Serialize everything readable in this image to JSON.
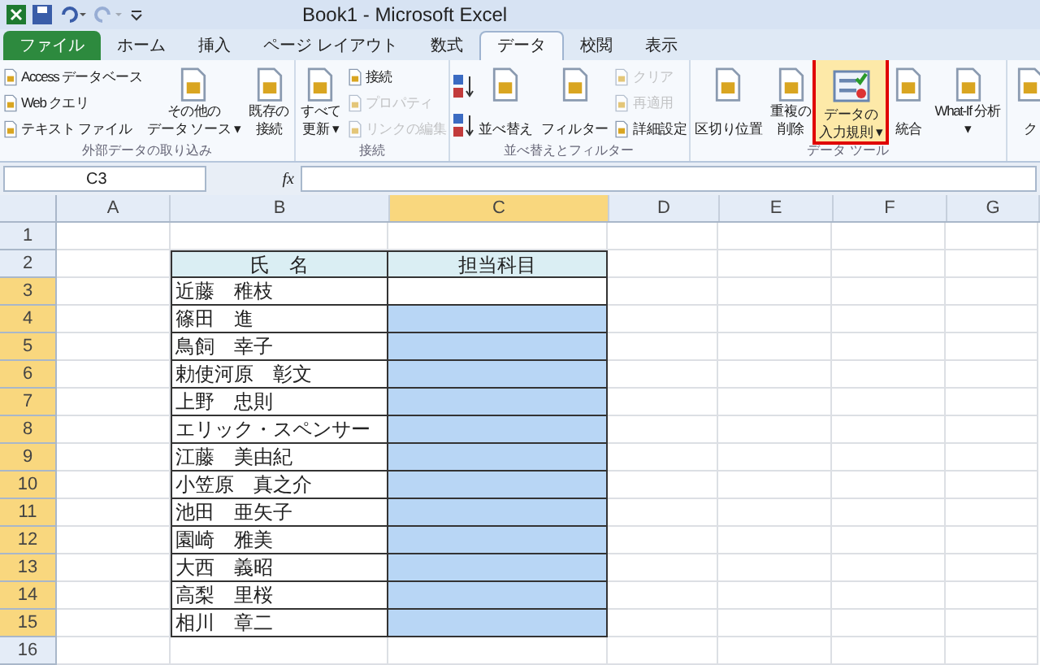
{
  "window": {
    "title": "Book1 - Microsoft Excel"
  },
  "tabs": [
    {
      "label": "ファイル",
      "kind": "file",
      "selected": false
    },
    {
      "label": "ホーム",
      "kind": "tab",
      "selected": false
    },
    {
      "label": "挿入",
      "kind": "tab",
      "selected": false
    },
    {
      "label": "ページ レイアウト",
      "kind": "tab",
      "selected": false
    },
    {
      "label": "数式",
      "kind": "tab",
      "selected": false
    },
    {
      "label": "データ",
      "kind": "tab",
      "selected": true
    },
    {
      "label": "校閲",
      "kind": "tab",
      "selected": false
    },
    {
      "label": "表示",
      "kind": "tab",
      "selected": false
    }
  ],
  "ribbon": {
    "groups": [
      {
        "label": "外部データの取り込み",
        "columns": [
          {
            "kind": "small",
            "items": [
              {
                "label": "Access データベース",
                "disabled": false
              },
              {
                "label": "Web クエリ",
                "disabled": false
              },
              {
                "label": "テキスト ファイル",
                "disabled": false
              }
            ]
          },
          {
            "kind": "large",
            "lines": [
              "その他の",
              "データ ソース ▾"
            ],
            "highlighted": false
          },
          {
            "kind": "large",
            "lines": [
              "既存の",
              "接続"
            ],
            "highlighted": false
          }
        ]
      },
      {
        "label": "接続",
        "columns": [
          {
            "kind": "large",
            "lines": [
              "すべて",
              "更新 ▾"
            ],
            "highlighted": false
          },
          {
            "kind": "small",
            "items": [
              {
                "label": "接続",
                "disabled": false
              },
              {
                "label": "プロパティ",
                "disabled": true
              },
              {
                "label": "リンクの編集",
                "disabled": true
              }
            ]
          }
        ]
      },
      {
        "label": "並べ替えとフィルター",
        "columns": [
          {
            "kind": "sort"
          },
          {
            "kind": "large",
            "lines": [
              "並べ替え"
            ],
            "highlighted": false
          },
          {
            "kind": "large",
            "lines": [
              "フィルター"
            ],
            "highlighted": false
          },
          {
            "kind": "small",
            "items": [
              {
                "label": "クリア",
                "disabled": true
              },
              {
                "label": "再適用",
                "disabled": true
              },
              {
                "label": "詳細設定",
                "disabled": false
              }
            ]
          }
        ]
      },
      {
        "label": "データ ツール",
        "columns": [
          {
            "kind": "large",
            "lines": [
              "区切り位置"
            ],
            "highlighted": false
          },
          {
            "kind": "large",
            "lines": [
              "重複の",
              "削除"
            ],
            "highlighted": false
          },
          {
            "kind": "large",
            "lines": [
              "データの",
              "入力規則 ▾"
            ],
            "highlighted": true
          },
          {
            "kind": "large",
            "lines": [
              "統合"
            ],
            "highlighted": false
          },
          {
            "kind": "large",
            "lines": [
              "What-If 分析",
              "▾"
            ],
            "highlighted": false
          }
        ]
      },
      {
        "columns": [
          {
            "kind": "large",
            "lines": [
              "ク"
            ],
            "highlighted": false
          }
        ]
      }
    ]
  },
  "formula_bar": {
    "name_box": "C3",
    "fx": "fx"
  },
  "sheet": {
    "columns": [
      {
        "label": "A",
        "selected": false
      },
      {
        "label": "B",
        "selected": false
      },
      {
        "label": "C",
        "selected": true
      },
      {
        "label": "D",
        "selected": false
      },
      {
        "label": "E",
        "selected": false
      },
      {
        "label": "F",
        "selected": false
      },
      {
        "label": "G",
        "selected": false
      }
    ],
    "rows": [
      {
        "number": "1",
        "selected": false,
        "cells": {}
      },
      {
        "number": "2",
        "selected": false,
        "header": true,
        "cells": {
          "b": "氏　名",
          "c": "担当科目"
        }
      },
      {
        "number": "3",
        "selected": true,
        "active": true,
        "cells": {
          "b": "近藤　稚枝"
        }
      },
      {
        "number": "4",
        "selected": true,
        "active": false,
        "cells": {
          "b": "篠田　進"
        }
      },
      {
        "number": "5",
        "selected": true,
        "active": false,
        "cells": {
          "b": "鳥飼　幸子"
        }
      },
      {
        "number": "6",
        "selected": true,
        "active": false,
        "cells": {
          "b": "勅使河原　彰文"
        }
      },
      {
        "number": "7",
        "selected": true,
        "active": false,
        "cells": {
          "b": "上野　忠則"
        }
      },
      {
        "number": "8",
        "selected": true,
        "active": false,
        "cells": {
          "b": "エリック・スペンサー"
        }
      },
      {
        "number": "9",
        "selected": true,
        "active": false,
        "cells": {
          "b": "江藤　美由紀"
        }
      },
      {
        "number": "10",
        "selected": true,
        "active": false,
        "cells": {
          "b": "小笠原　真之介"
        }
      },
      {
        "number": "11",
        "selected": true,
        "active": false,
        "cells": {
          "b": "池田　亜矢子"
        }
      },
      {
        "number": "12",
        "selected": true,
        "active": false,
        "cells": {
          "b": "園崎　雅美"
        }
      },
      {
        "number": "13",
        "selected": true,
        "active": false,
        "cells": {
          "b": "大西　義昭"
        }
      },
      {
        "number": "14",
        "selected": true,
        "active": false,
        "cells": {
          "b": "高梨　里桜"
        }
      },
      {
        "number": "15",
        "selected": true,
        "active": false,
        "cells": {
          "b": "相川　章二"
        }
      },
      {
        "number": "16",
        "selected": false,
        "cells": {}
      }
    ]
  }
}
